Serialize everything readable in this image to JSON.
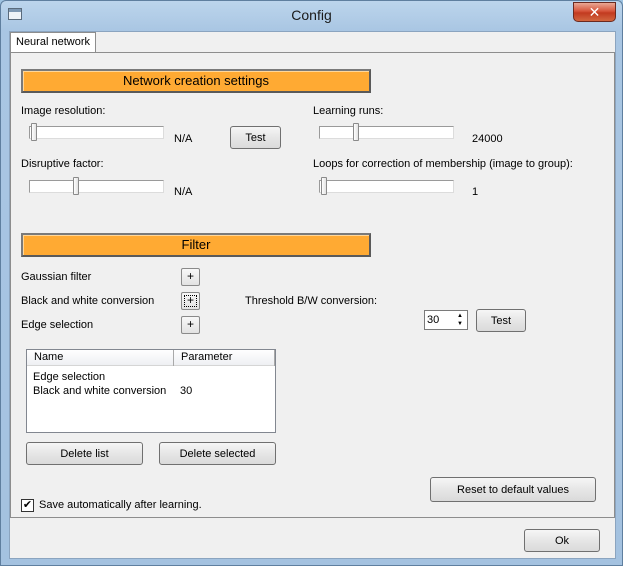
{
  "window": {
    "title": "Config",
    "close_glyph": "✕"
  },
  "tabs": [
    {
      "label": "Neural network",
      "active": true
    }
  ],
  "network_section": {
    "header": "Network creation settings",
    "image_resolution": {
      "label": "Image resolution:",
      "value_text": "N/A",
      "slider_fraction": 0.0
    },
    "test_button": "Test",
    "learning_runs": {
      "label": "Learning runs:",
      "value_text": "24000",
      "slider_fraction": 0.28
    },
    "disruptive_factor": {
      "label": "Disruptive factor:",
      "value_text": "N/A",
      "slider_fraction": 0.35
    },
    "loops_correction": {
      "label": "Loops for correction of membership (image to group):",
      "value_text": "1",
      "slider_fraction": 0.0
    }
  },
  "filter_section": {
    "header": "Filter",
    "gaussian": {
      "label": "Gaussian filter",
      "button": "+"
    },
    "bw_conversion": {
      "label": "Black and white conversion",
      "button": "+"
    },
    "edge_selection": {
      "label": "Edge selection",
      "button": "+"
    },
    "threshold": {
      "label": "Threshold B/W conversion:",
      "value": "30",
      "test_button": "Test"
    }
  },
  "filter_list": {
    "columns": [
      "Name",
      "Parameter"
    ],
    "rows": [
      {
        "name": "Edge selection",
        "parameter": ""
      },
      {
        "name": "Black and white conversion",
        "parameter": "30"
      }
    ]
  },
  "buttons": {
    "delete_list": "Delete list",
    "delete_selected": "Delete selected",
    "reset_defaults": "Reset to default values",
    "ok": "Ok"
  },
  "save_auto": {
    "label": "Save automatically after learning.",
    "checked": true,
    "check_glyph": "✔"
  },
  "colors": {
    "section_header": "#ffaa33",
    "title_bar": "#a9c6e3",
    "close_button": "#c23a20"
  }
}
